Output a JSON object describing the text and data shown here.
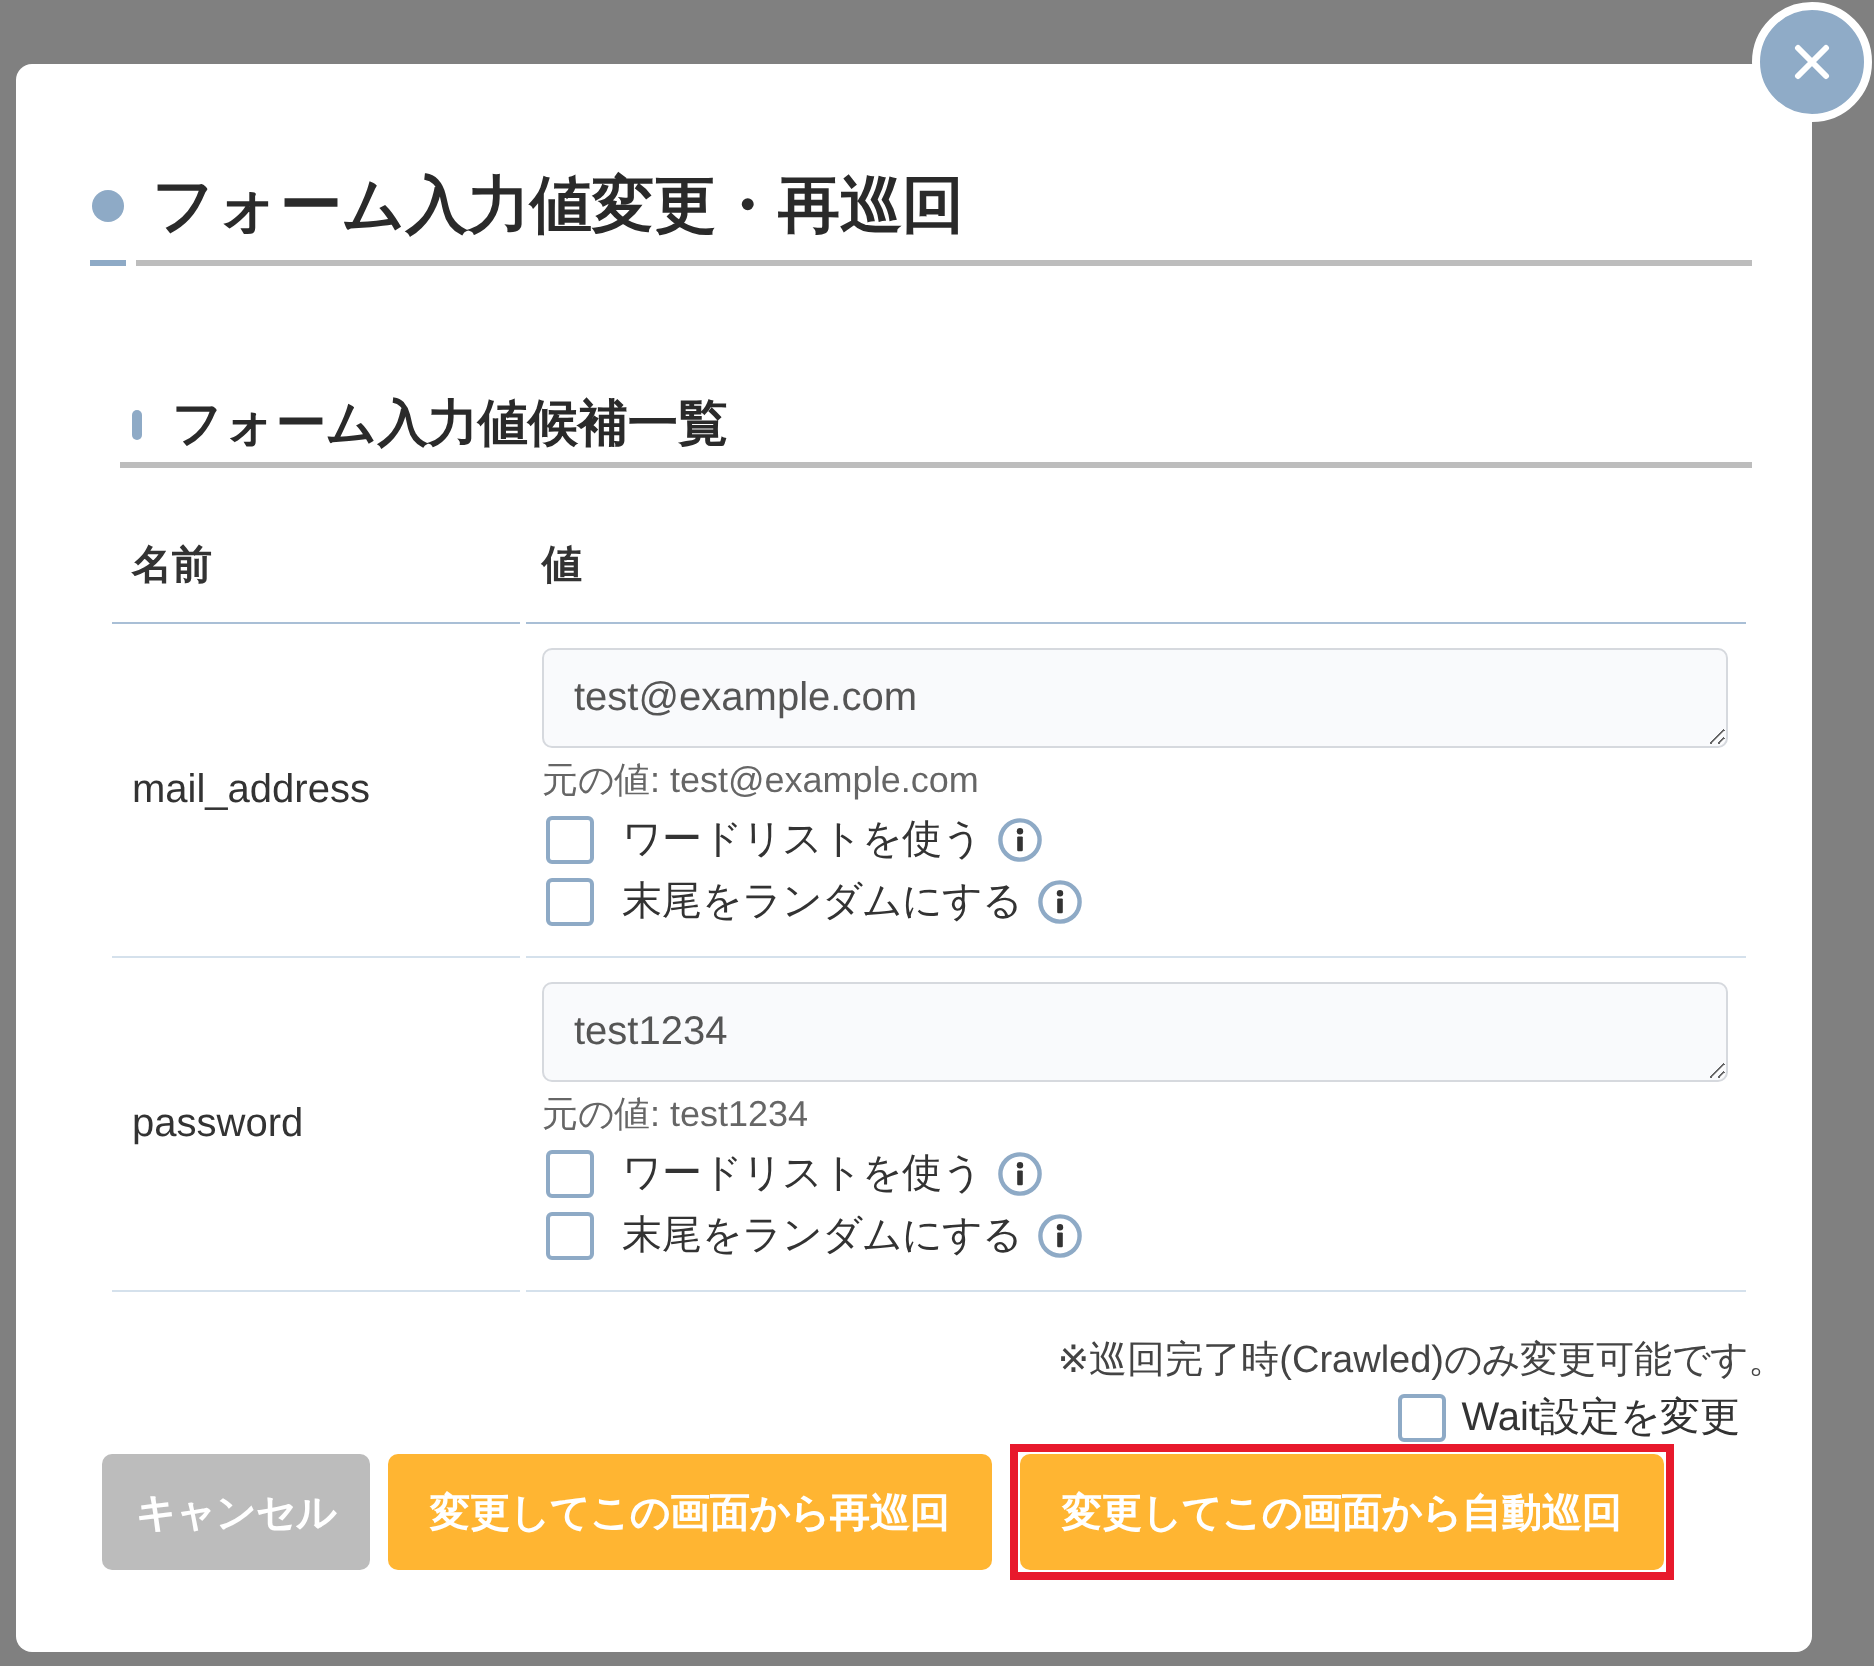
{
  "dialog": {
    "title": "フォーム入力値変更・再巡回"
  },
  "section": {
    "title": "フォーム入力値候補一覧"
  },
  "table": {
    "columns": [
      "名前",
      "値"
    ],
    "rows": [
      {
        "name": "mail_address",
        "value": "test@example.com",
        "original": "元の値: test@example.com",
        "options": [
          {
            "label": "ワードリストを使う",
            "checked": false
          },
          {
            "label": "末尾をランダムにする",
            "checked": false
          }
        ]
      },
      {
        "name": "password",
        "value": "test1234",
        "original": "元の値: test1234",
        "options": [
          {
            "label": "ワードリストを使う",
            "checked": false
          },
          {
            "label": "末尾をランダムにする",
            "checked": false
          }
        ]
      }
    ]
  },
  "note": "※巡回完了時(Crawled)のみ変更可能です。",
  "wait_option": {
    "label": "Wait設定を変更",
    "checked": false
  },
  "buttons": [
    {
      "label": "キャンセル",
      "kind": "cancel",
      "highlighted": false
    },
    {
      "label": "変更してこの画面から再巡回",
      "kind": "primary",
      "highlighted": false
    },
    {
      "label": "変更してこの画面から自動巡回",
      "kind": "primary",
      "highlighted": true
    }
  ]
}
